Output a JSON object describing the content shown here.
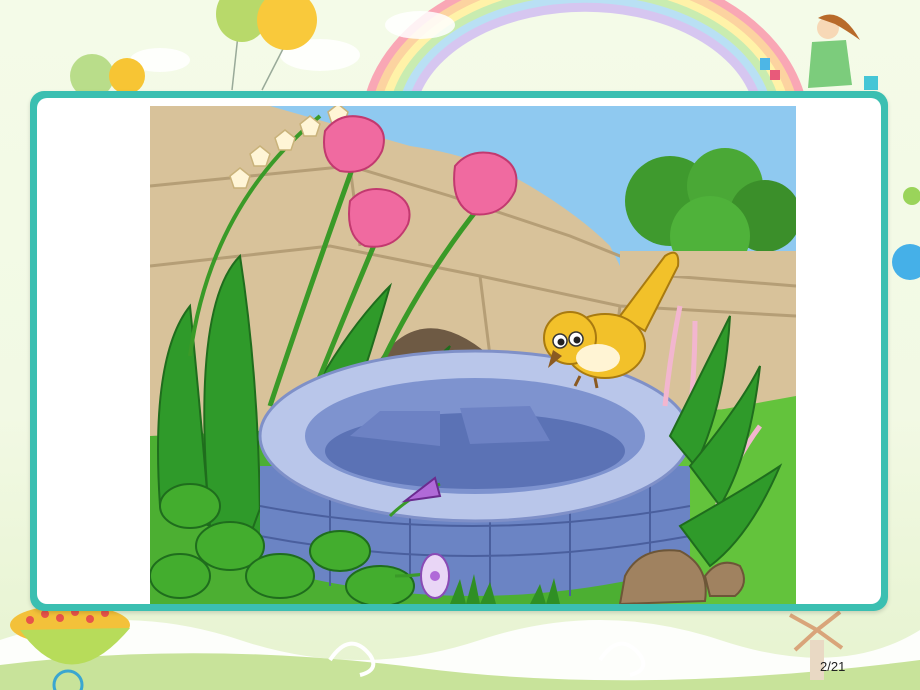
{
  "slide": {
    "page_number": "2/21"
  },
  "colors": {
    "frame": "#3bbfb1",
    "sky": "#8fc9f0",
    "well_stone": "#8ea3d6",
    "bird": "#f2c12a",
    "tulip": "#f06aa0",
    "grass": "#3aa52a"
  },
  "illustration": {
    "subject": "bird-on-well",
    "elements": [
      "sky",
      "rock-wall",
      "tree",
      "tulips",
      "lily-of-the-valley",
      "stone-well",
      "yellow-bird",
      "grass",
      "morning-glory",
      "rocks"
    ]
  }
}
